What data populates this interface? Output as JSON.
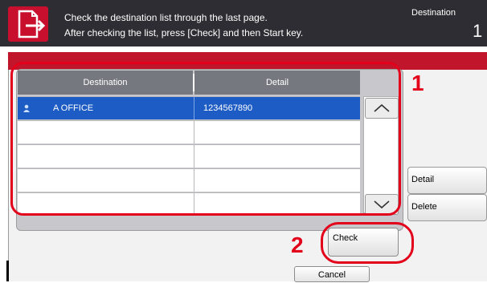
{
  "header": {
    "message_line1": "Check the destination list through the last page.",
    "message_line2": "After checking the list, press [Check] and then Start key.",
    "destination_label": "Destination",
    "destination_count": "1"
  },
  "table": {
    "columns": [
      "Destination",
      "Detail"
    ],
    "rows": [
      {
        "destination": "A OFFICE",
        "detail": "1234567890",
        "selected": true
      },
      {
        "destination": "",
        "detail": ""
      },
      {
        "destination": "",
        "detail": ""
      },
      {
        "destination": "",
        "detail": ""
      },
      {
        "destination": "",
        "detail": ""
      }
    ]
  },
  "buttons": {
    "detail": "Detail",
    "delete": "Delete",
    "check": "Check",
    "cancel": "Cancel"
  },
  "callouts": {
    "one": "1",
    "two": "2"
  },
  "colors": {
    "header_bg": "#2d2d33",
    "accent_red": "#c0152b",
    "selected_row": "#1d5cc4",
    "callout": "#e3001b"
  },
  "icons": {
    "header": "document-send-icon",
    "row": "contact-icon",
    "scroll_up": "chevron-up-icon",
    "scroll_down": "chevron-down-icon"
  }
}
